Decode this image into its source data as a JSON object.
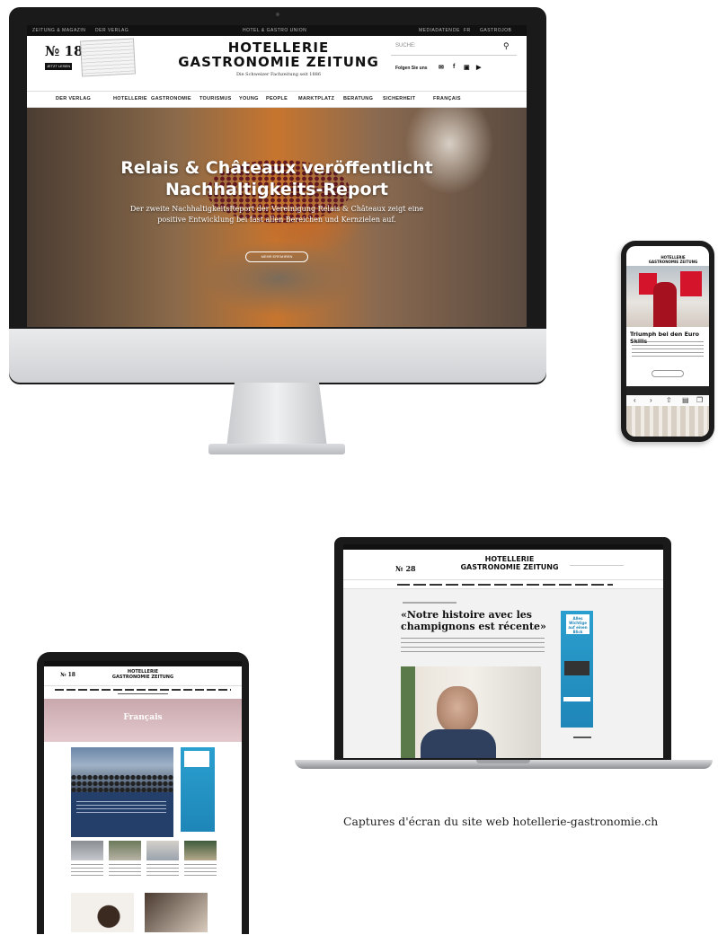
{
  "desktop": {
    "topbar": {
      "left1": "ZEITUNG & MAGAZIN",
      "left2": "DER VERLAG",
      "center": "HOTEL & GASTRO UNION",
      "right1": "MEDIADATEN",
      "lang_de": "DE",
      "lang_fr": "FR",
      "right2": "GASTROJOB"
    },
    "issue": "№ 18",
    "issue_button": "JETZT LESEN",
    "logo_line1": "HOTELLERIE",
    "logo_line2": "GASTRONOMIE ZEITUNG",
    "logo_subtitle": "Die Schweizer Fachzeitung seit 1886",
    "search_placeholder": "SUCHE:",
    "follow_label": "Folgen Sie uns",
    "nav": [
      "DER VERLAG",
      "HOTELLERIE",
      "GASTRONOMIE",
      "TOURISMUS",
      "YOUNG",
      "PEOPLE",
      "MARKTPLATZ",
      "BERATUNG",
      "SICHERHEIT",
      "FRANÇAIS"
    ],
    "hero": {
      "title_line1": "Relais & Châteaux veröffentlicht",
      "title_line2": "Nachhaltigkeits-Report",
      "desc_line1": "Der zweite NachhaltigkeitsReport der Vereinigung Relais & Châteaux zeigt eine",
      "desc_line2": "positive Entwicklung bei fast allen Bereichen und Kernzielen auf.",
      "button": "MEHR ERFAHREN"
    }
  },
  "phone": {
    "logo": "HOTELLERIE GASTRONOMIE ZEITUNG",
    "headline": "Triumph bei den Euro Skills"
  },
  "laptop": {
    "issue": "№ 28",
    "logo_line1": "HOTELLERIE",
    "logo_line2": "GASTRONOMIE ZEITUNG",
    "headline": "«Notre histoire avec les champignons est récente»",
    "ad_text": "Alles Wichtige auf einen Blick"
  },
  "tablet": {
    "issue": "№ 18",
    "logo_line1": "HOTELLERIE",
    "logo_line2": "GASTRONOMIE ZEITUNG",
    "banner": "Français"
  },
  "caption": "Captures d'écran du site web hotellerie-gastronomie.ch",
  "colors": {
    "device_frame": "#1a1a1a",
    "tablet_banner": "#d4b3b8",
    "ad_blue": "#1f86b8",
    "card_navy": "#243f6a"
  }
}
